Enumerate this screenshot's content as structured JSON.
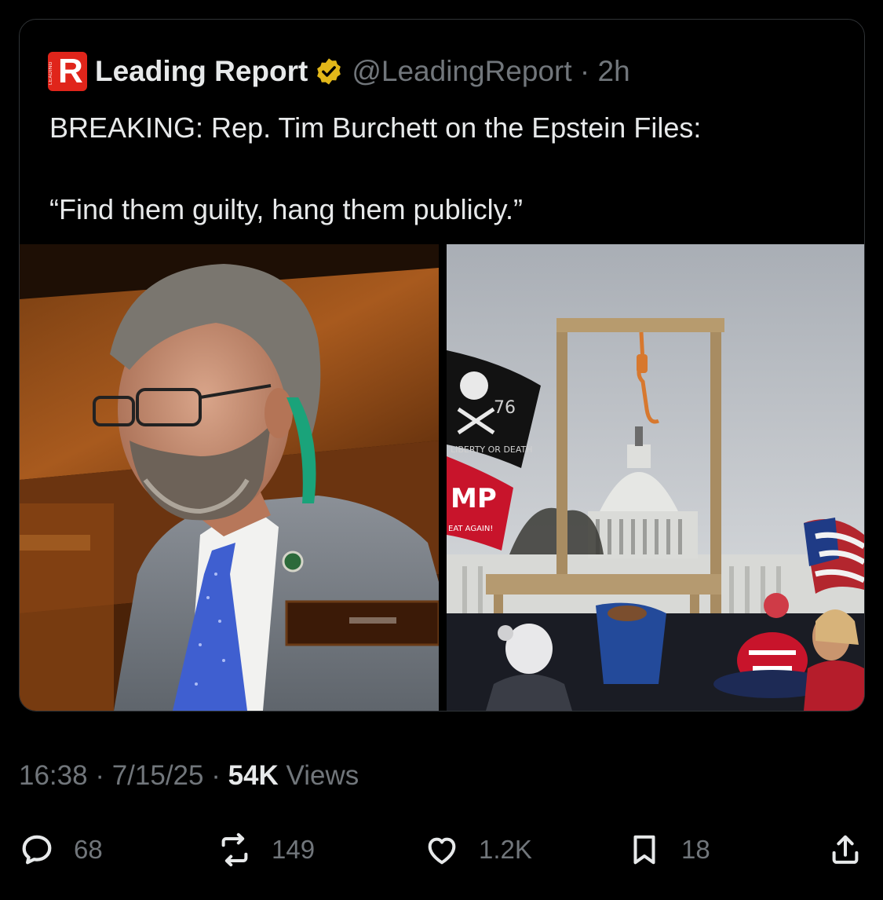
{
  "quoted_post": {
    "author_name": "Leading Report",
    "logo_letter": "R",
    "logo_small_text": "LEADING",
    "handle_time": "@LeadingReport · 2h",
    "line1": "BREAKING: Rep. Tim Burchett on the Epstein Files:",
    "line2": "“Find them guilty, hang them publicly.”",
    "right_image_flag_text": "MP",
    "right_image_flag_subtext": "EAT AGAIN!",
    "right_image_pirate_text": "LIBERTY OR DEATH",
    "right_image_pirate_number": "76"
  },
  "post_meta": {
    "time": "16:38",
    "date": "7/15/25",
    "views_count": "54K",
    "views_label": "Views"
  },
  "actions": {
    "replies": "68",
    "reposts": "149",
    "likes": "1.2K",
    "bookmarks": "18"
  },
  "colors": {
    "background": "#000000",
    "text": "#e7e9ea",
    "muted": "#71767b",
    "border": "#2f3336",
    "verified_gold": "#e2b719",
    "logo_red": "#e0251b"
  }
}
